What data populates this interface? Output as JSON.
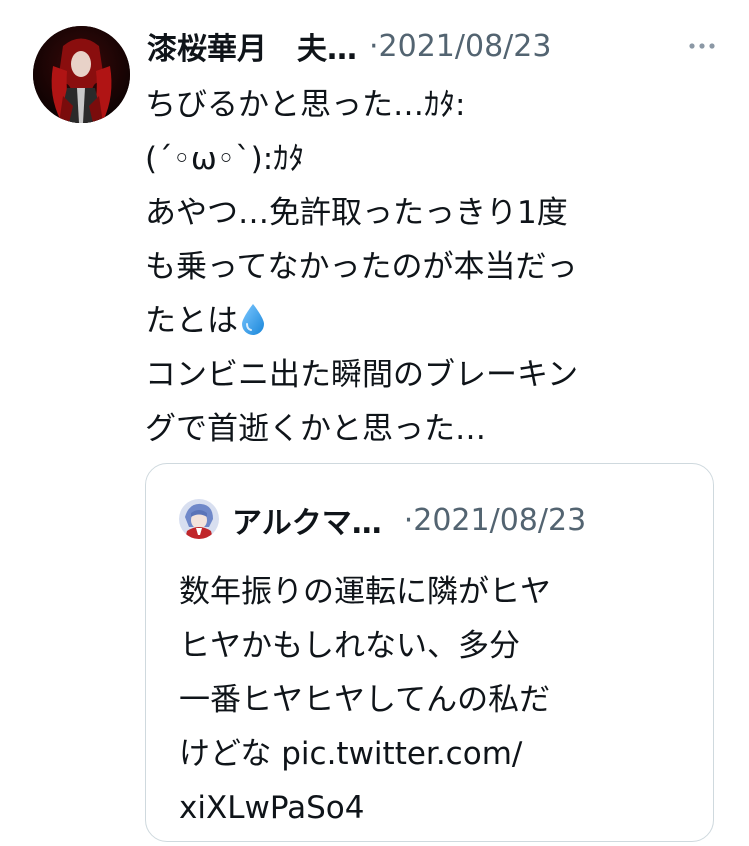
{
  "tweet": {
    "author_name": "漆桜華月　夫…",
    "date_separator": "·",
    "date": "2021/08/23",
    "more_icon": "more-horizontal-icon",
    "lines": [
      "ちびるかと思った…ｶﾀ:",
      "(´◦ω◦`):ｶﾀ",
      "あやつ…免許取ったっきり1度",
      "も乗ってなかったのが本当だっ",
      "たとは",
      "コンビニ出た瞬間のブレーキン",
      "グで首逝くかと思った…"
    ],
    "emoji": "droplet-icon"
  },
  "quoted_tweet": {
    "author_name": "アルクマ…",
    "date_separator": "·",
    "date": "2021/08/23",
    "lines": [
      "数年振りの運転に隣がヒヤ",
      "ヒヤかもしれない、多分",
      "一番ヒヤヒヤしてんの私だ",
      "けどな pic.twitter.com/",
      "xiXLwPaSo4"
    ]
  },
  "colors": {
    "text_primary": "#0f1419",
    "text_secondary": "#536471",
    "border": "#cfd9de",
    "droplet": "#1d9bf0"
  }
}
